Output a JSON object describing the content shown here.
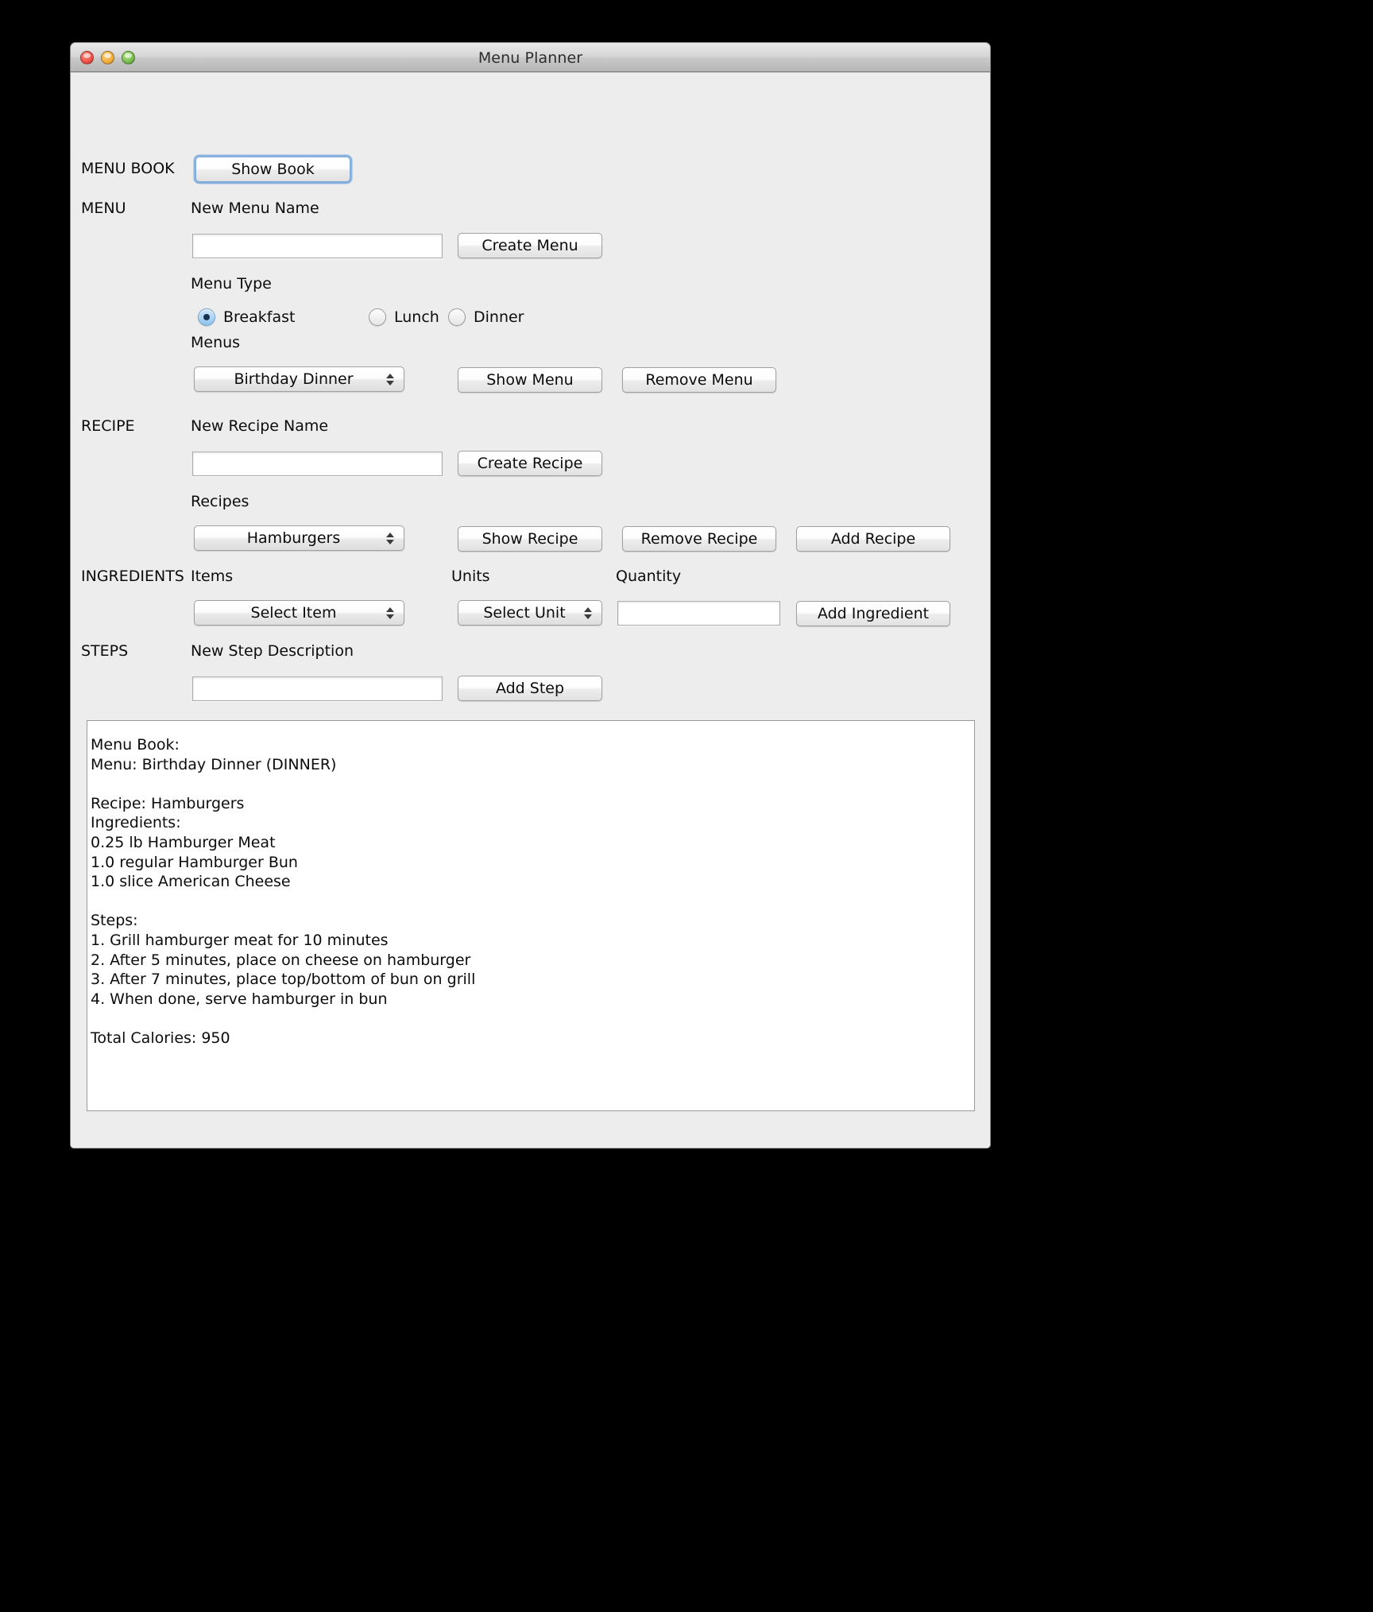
{
  "window": {
    "title": "Menu Planner",
    "traffic_lights": [
      "close-button",
      "minimize-button",
      "zoom-button"
    ]
  },
  "sections": {
    "menu_book": {
      "label": "MENU BOOK",
      "show_book_button": "Show Book"
    },
    "menu": {
      "label": "MENU",
      "new_menu_name_label": "New Menu Name",
      "new_menu_name_value": "",
      "new_menu_name_placeholder": "",
      "create_menu_button": "Create Menu",
      "menu_type_label": "Menu Type",
      "menu_type_options": [
        "Breakfast",
        "Lunch",
        "Dinner"
      ],
      "menu_type_selected": "Breakfast",
      "menus_label": "Menus",
      "menus_selected": "Birthday Dinner",
      "menus_options": [
        "Birthday Dinner"
      ],
      "show_menu_button": "Show Menu",
      "remove_menu_button": "Remove Menu"
    },
    "recipe": {
      "label": "RECIPE",
      "new_recipe_name_label": "New Recipe Name",
      "new_recipe_name_value": "",
      "new_recipe_name_placeholder": "",
      "create_recipe_button": "Create Recipe",
      "recipes_label": "Recipes",
      "recipes_selected": "Hamburgers",
      "recipes_options": [
        "Hamburgers"
      ],
      "show_recipe_button": "Show Recipe",
      "remove_recipe_button": "Remove Recipe",
      "add_recipe_button": "Add Recipe"
    },
    "ingredients": {
      "label": "INGREDIENTS",
      "items_label": "Items",
      "items_selected": "Select Item",
      "units_label": "Units",
      "units_selected": "Select Unit",
      "quantity_label": "Quantity",
      "quantity_value": "",
      "quantity_placeholder": "",
      "add_ingredient_button": "Add Ingredient"
    },
    "steps": {
      "label": "STEPS",
      "new_step_description_label": "New Step Description",
      "new_step_description_value": "",
      "new_step_description_placeholder": "",
      "add_step_button": "Add Step"
    }
  },
  "output": {
    "text": "Menu Book:\nMenu: Birthday Dinner (DINNER)\n\nRecipe: Hamburgers\nIngredients:\n0.25 lb Hamburger Meat\n1.0 regular Hamburger Bun\n1.0 slice American Cheese\n\nSteps:\n1. Grill hamburger meat for 10 minutes\n2. After 5 minutes, place on cheese on hamburger\n3. After 7 minutes, place top/bottom of bun on grill\n4. When done, serve hamburger in bun\n\nTotal Calories: 950"
  },
  "colors": {
    "window_bg": "#ededed",
    "focus_ring": "#6aa0dc",
    "radio_selected": "#8fc3ee",
    "text": "#0c0c0c"
  }
}
